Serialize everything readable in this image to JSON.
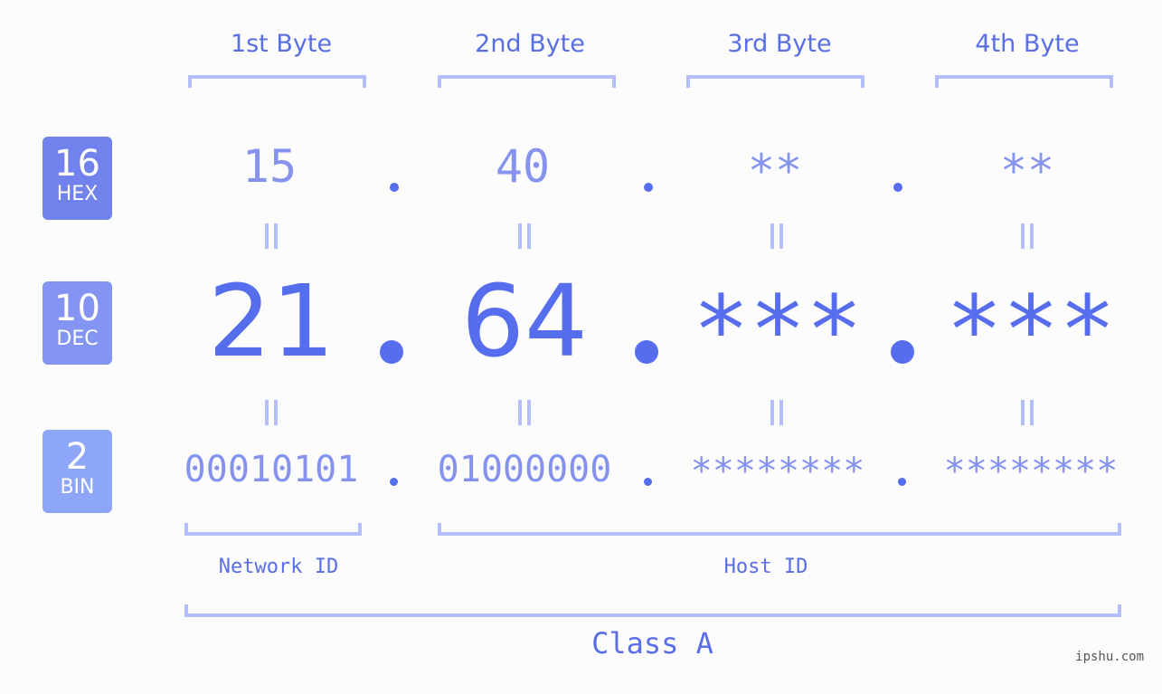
{
  "bytes": {
    "headers": [
      "1st Byte",
      "2nd Byte",
      "3rd Byte",
      "4th Byte"
    ]
  },
  "badges": {
    "hex": {
      "number": "16",
      "label": "HEX",
      "color": "#7282ec"
    },
    "dec": {
      "number": "10",
      "label": "DEC",
      "color": "#8494f2"
    },
    "bin": {
      "number": "2",
      "label": "BIN",
      "color": "#8ea6f8"
    }
  },
  "values": {
    "hex": [
      "15",
      "40",
      "**",
      "**"
    ],
    "dec": [
      "21",
      "64",
      "***",
      "***"
    ],
    "bin": [
      "00010101",
      "01000000",
      "********",
      "********"
    ]
  },
  "separator": ".",
  "equals_symbol": "||",
  "segments": {
    "network_id": "Network ID",
    "host_id": "Host ID",
    "class_label": "Class A"
  },
  "watermark": "ipshu.com",
  "colors": {
    "accent": "#566ded",
    "light_accent": "#8592ee",
    "bracket": "#b3befa",
    "background": "#fbfcfb"
  }
}
